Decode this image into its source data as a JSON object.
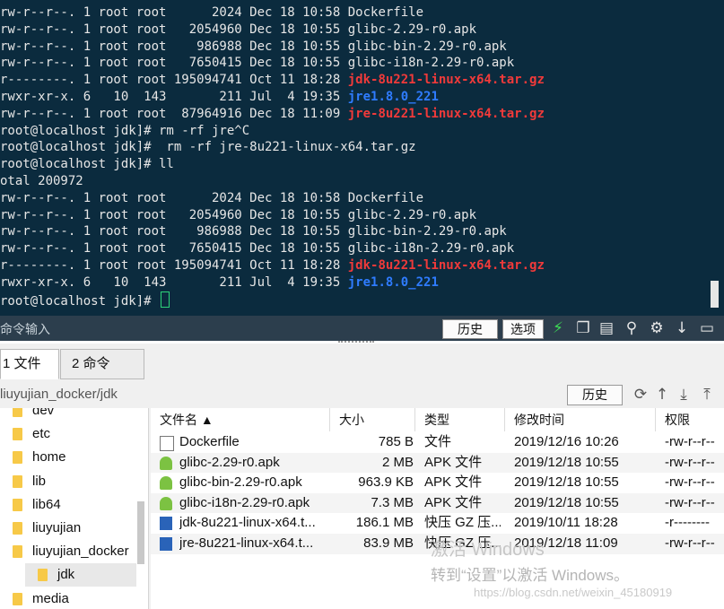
{
  "terminal": {
    "lines": [
      {
        "pre": "rw-r--r--. 1 root root      2024 Dec 18 10:58 ",
        "name": "Dockerfile",
        "color": "normal"
      },
      {
        "pre": "rw-r--r--. 1 root root   2054960 Dec 18 10:55 ",
        "name": "glibc-2.29-r0.apk",
        "color": "normal"
      },
      {
        "pre": "rw-r--r--. 1 root root    986988 Dec 18 10:55 ",
        "name": "glibc-bin-2.29-r0.apk",
        "color": "normal"
      },
      {
        "pre": "rw-r--r--. 1 root root   7650415 Dec 18 10:55 ",
        "name": "glibc-i18n-2.29-r0.apk",
        "color": "normal"
      },
      {
        "pre": "r--------. 1 root root 195094741 Oct 11 18:28 ",
        "name": "jdk-8u221-linux-x64.tar.gz",
        "color": "red"
      },
      {
        "pre": "rwxr-xr-x. 6   10  143       211 Jul  4 19:35 ",
        "name": "jre1.8.0_221",
        "color": "blue"
      },
      {
        "pre": "rw-r--r--. 1 root root  87964916 Dec 18 11:09 ",
        "name": "jre-8u221-linux-x64.tar.gz",
        "color": "red"
      },
      {
        "pre": "root@localhost jdk]# rm -rf jre^C",
        "name": "",
        "color": "normal"
      },
      {
        "pre": "root@localhost jdk]#  rm -rf jre-8u221-linux-x64.tar.gz",
        "name": "",
        "color": "normal"
      },
      {
        "pre": "root@localhost jdk]# ll",
        "name": "",
        "color": "normal"
      },
      {
        "pre": "otal 200972",
        "name": "",
        "color": "normal"
      },
      {
        "pre": "rw-r--r--. 1 root root      2024 Dec 18 10:58 ",
        "name": "Dockerfile",
        "color": "normal"
      },
      {
        "pre": "rw-r--r--. 1 root root   2054960 Dec 18 10:55 ",
        "name": "glibc-2.29-r0.apk",
        "color": "normal"
      },
      {
        "pre": "rw-r--r--. 1 root root    986988 Dec 18 10:55 ",
        "name": "glibc-bin-2.29-r0.apk",
        "color": "normal"
      },
      {
        "pre": "rw-r--r--. 1 root root   7650415 Dec 18 10:55 ",
        "name": "glibc-i18n-2.29-r0.apk",
        "color": "normal"
      },
      {
        "pre": "r--------. 1 root root 195094741 Oct 11 18:28 ",
        "name": "jdk-8u221-linux-x64.tar.gz",
        "color": "red"
      },
      {
        "pre": "rwxr-xr-x. 6   10  143       211 Jul  4 19:35 ",
        "name": "jre1.8.0_221",
        "color": "blue"
      },
      {
        "pre": "root@localhost jdk]# ",
        "name": "",
        "color": "normal"
      }
    ]
  },
  "cmdbar": {
    "input_placeholder": "命令输入",
    "history_label": "历史",
    "options_label": "选项"
  },
  "tabs": [
    {
      "label": "1 文件"
    },
    {
      "label": "2 命令"
    }
  ],
  "path": {
    "value": "liuyujian_docker/jdk",
    "history_label": "历史"
  },
  "tree": [
    {
      "label": "dev"
    },
    {
      "label": "etc"
    },
    {
      "label": "home"
    },
    {
      "label": "lib"
    },
    {
      "label": "lib64"
    },
    {
      "label": "liuyujian"
    },
    {
      "label": "liuyujian_docker"
    },
    {
      "label": "jdk"
    },
    {
      "label": "media"
    }
  ],
  "table": {
    "headers": {
      "name": "文件名 ▲",
      "size": "大小",
      "type": "类型",
      "mtime": "修改时间",
      "perm": "权限"
    },
    "rows": [
      {
        "name": "Dockerfile",
        "size": "785 B",
        "type": "文件",
        "mtime": "2019/12/16 10:26",
        "perm": "-rw-r--r--",
        "icon": "file-icon"
      },
      {
        "name": "glibc-2.29-r0.apk",
        "size": "2 MB",
        "type": "APK 文件",
        "mtime": "2019/12/18 10:55",
        "perm": "-rw-r--r--",
        "icon": "android-icon"
      },
      {
        "name": "glibc-bin-2.29-r0.apk",
        "size": "963.9 KB",
        "type": "APK 文件",
        "mtime": "2019/12/18 10:55",
        "perm": "-rw-r--r--",
        "icon": "android-icon"
      },
      {
        "name": "glibc-i18n-2.29-r0.apk",
        "size": "7.3 MB",
        "type": "APK 文件",
        "mtime": "2019/12/18 10:55",
        "perm": "-rw-r--r--",
        "icon": "android-icon"
      },
      {
        "name": "jdk-8u221-linux-x64.t...",
        "size": "186.1 MB",
        "type": "快压 GZ 压...",
        "mtime": "2019/10/11 18:28",
        "perm": "-r--------",
        "icon": "archive-icon"
      },
      {
        "name": "jre-8u221-linux-x64.t...",
        "size": "83.9 MB",
        "type": "快压 GZ 压...",
        "mtime": "2019/12/18 11:09",
        "perm": "-rw-r--r--",
        "icon": "archive-icon"
      }
    ]
  },
  "watermark": {
    "line1": "激活 Windows",
    "line2": "转到“设置”以激活 Windows。",
    "line3": "https://blog.csdn.net/weixin_45180919"
  }
}
